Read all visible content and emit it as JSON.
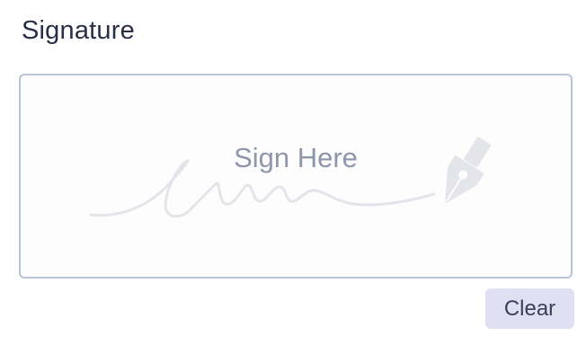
{
  "field": {
    "label": "Signature"
  },
  "pad": {
    "hint": "Sign Here"
  },
  "actions": {
    "clear_label": "Clear"
  },
  "colors": {
    "label_text": "#2b2f45",
    "pad_border": "#b9c4d6",
    "hint_text": "#8e96aa",
    "flourish": "#e4e5eb",
    "button_bg": "#dfe1f3",
    "button_text": "#3a3f5c"
  },
  "icons": {
    "pen": "fountain-pen-nib-icon"
  }
}
